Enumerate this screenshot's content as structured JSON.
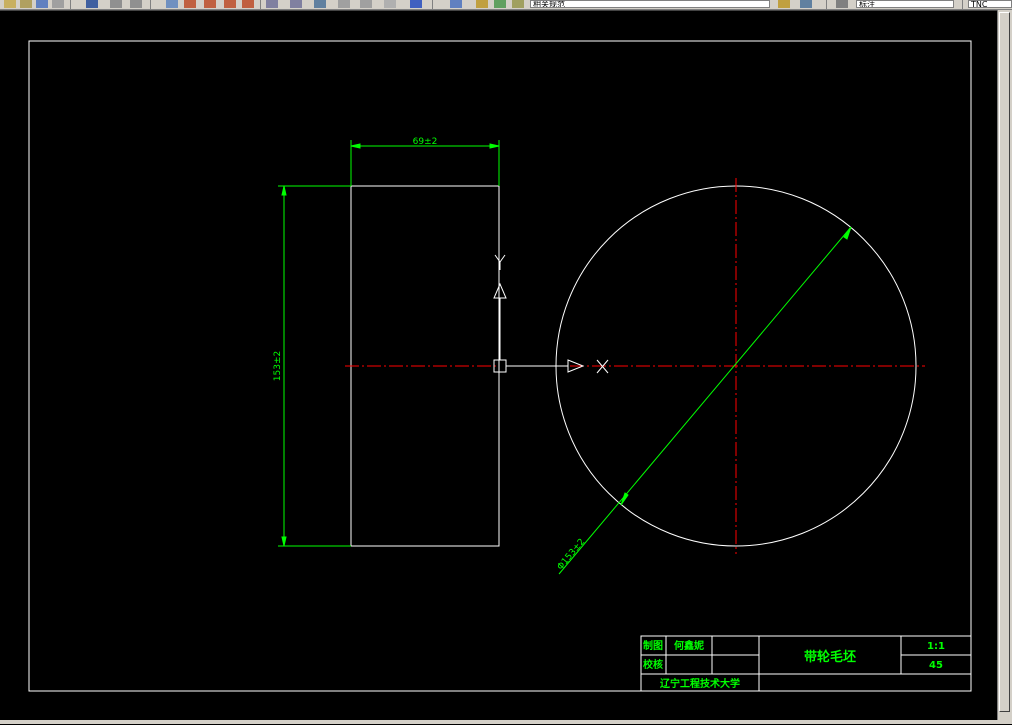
{
  "toolbar": {
    "layer_label": "相关规范",
    "style_label": "标注",
    "extra_label": "TNC"
  },
  "drawing": {
    "dimensions": {
      "width": "69±2",
      "height": "153±2",
      "diameter": "Φ153±2"
    },
    "ucs": {
      "x_label": "X",
      "y_label": "Y"
    },
    "title_block": {
      "drawn_label": "制图",
      "drawn_name": "何鑫妮",
      "checked_label": "校核",
      "part_name": "带轮毛坯",
      "scale": "1:1",
      "material": "45",
      "school": "辽宁工程技术大学"
    }
  },
  "colors": {
    "frame": "#ffffff",
    "dimension": "#00ff00",
    "centerline": "#ff0000",
    "ucs": "#ffffff"
  }
}
